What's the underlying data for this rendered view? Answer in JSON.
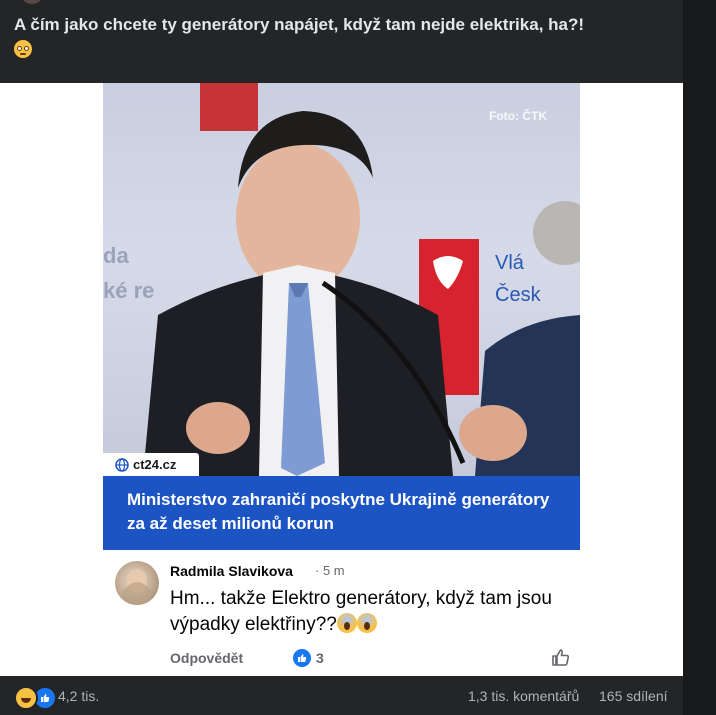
{
  "post": {
    "text": "A čím jako chcete ty generátory napájet, když tam nejde elektrika, ha?!",
    "text_emoji": "flushed-face-emoji"
  },
  "image": {
    "photo_credit": "Foto: ČTK",
    "source_label": "ct24.cz",
    "headline": "Ministerstvo zahraničí poskytne Ukrajině generátory za až deset milionů korun"
  },
  "comment": {
    "author": "Radmila Slavikova",
    "time": "· 5 m",
    "text": "Hm... takže Elektro generátory, když tam jsou výpadky elektřiny??",
    "text_emoji": "screaming-face-emoji",
    "reply_label": "Odpovědět",
    "like_count": "3"
  },
  "footer": {
    "reactions_count": "4,2 tis.",
    "comments_count": "1,3 tis. komentářů",
    "shares_count": "165 sdílení"
  },
  "colors": {
    "background": "#242526",
    "banner": "#1c54c4",
    "facebook_blue": "#1877f2",
    "secondary_text": "#b0b3b8"
  }
}
